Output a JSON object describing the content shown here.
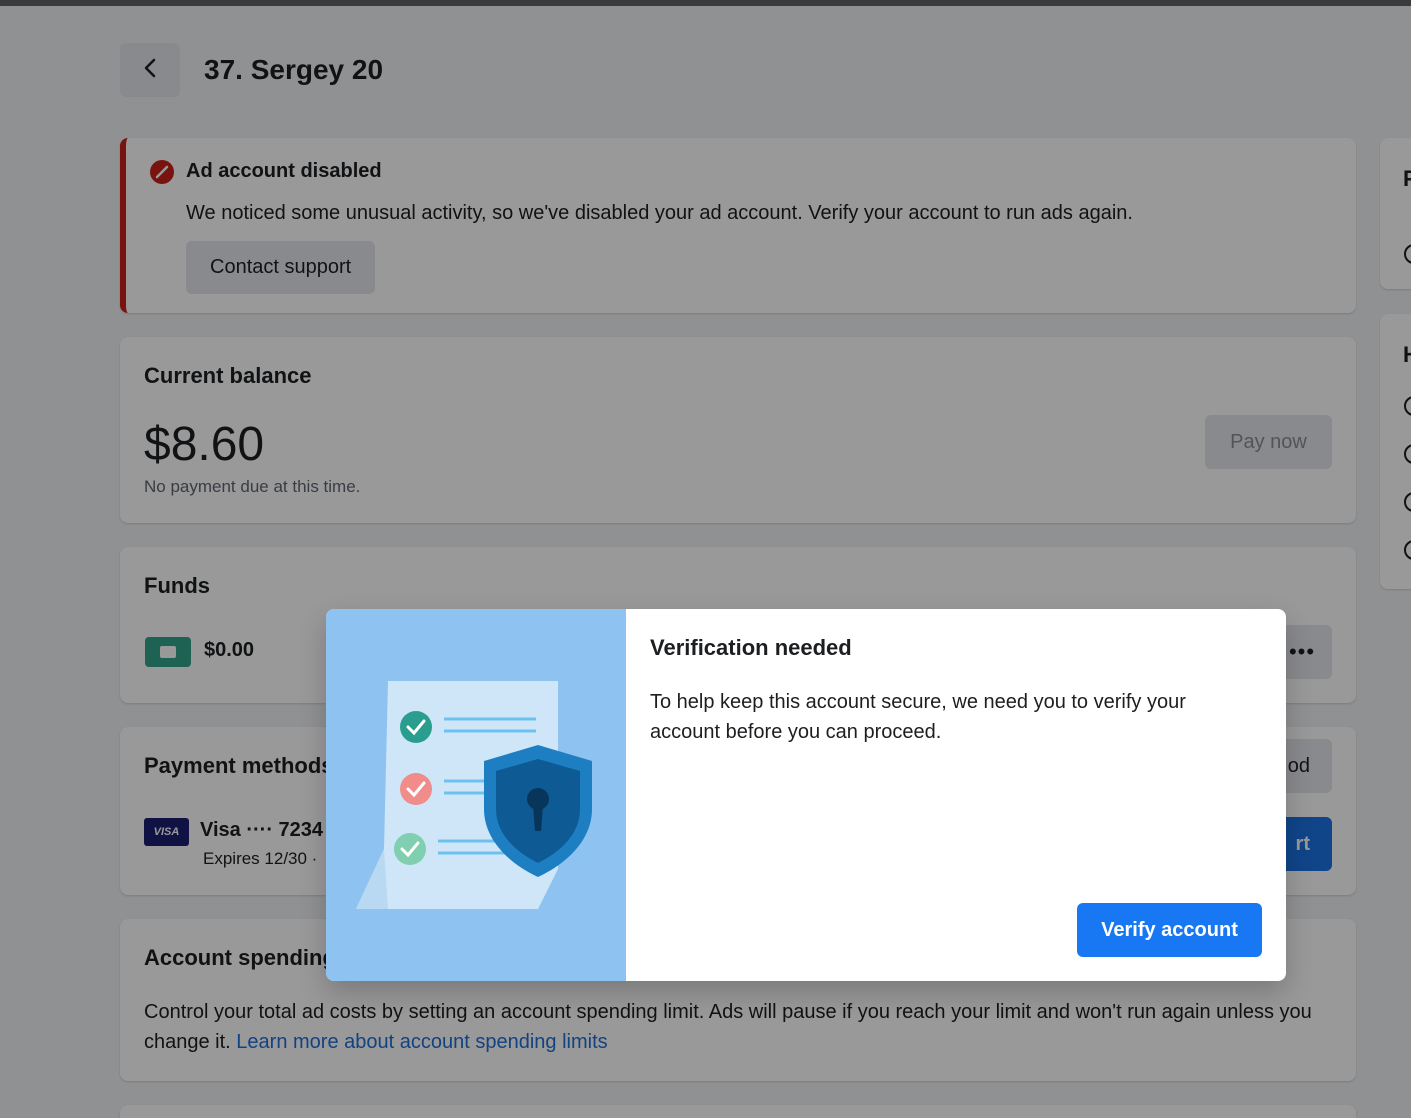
{
  "header": {
    "title": "37. Sergey 20"
  },
  "alert": {
    "title": "Ad account disabled",
    "message": "We noticed some unusual activity, so we've disabled your ad account. Verify your account to run ads again.",
    "contact_label": "Contact support"
  },
  "balance": {
    "title": "Current balance",
    "amount": "$8.60",
    "note": "No payment due at this time.",
    "pay_label": "Pay now"
  },
  "funds": {
    "title": "Funds",
    "amount": "$0.00",
    "more_label": "•••"
  },
  "payment": {
    "title": "Payment methods",
    "card_brand": "VISA",
    "card_label": "Visa ···· 7234",
    "expires": "Expires 12/30 · ",
    "add_label": "od",
    "blue_label": "rt"
  },
  "spending": {
    "title": "Account spending limit",
    "text": "Control your total ad costs by setting an account spending limit. Ads will pause if you reach your limit and won't run again unless you change it. ",
    "link": "Learn more about account spending limits"
  },
  "side": {
    "card1_letter": "F",
    "card2_letter": "H"
  },
  "modal": {
    "title": "Verification needed",
    "text": "To help keep this account secure, we need you to verify your account before you can proceed.",
    "verify_label": "Verify account"
  },
  "colors": {
    "danger": "#c9201c",
    "primary": "#1877f2",
    "art_bg": "#8ec2f0"
  }
}
